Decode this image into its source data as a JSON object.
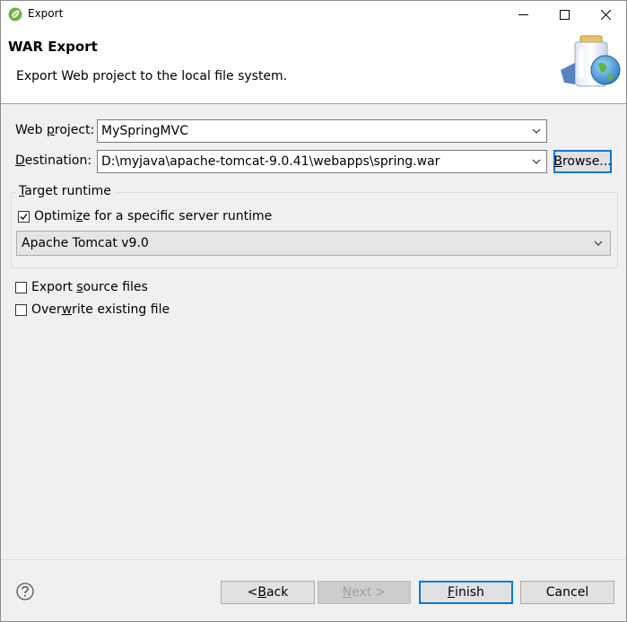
{
  "window": {
    "title": "Export",
    "icon": "spring-leaf-icon"
  },
  "controls": {
    "minimize": "minimize-icon",
    "maximize": "maximize-icon",
    "close": "close-icon"
  },
  "banner": {
    "title": "WAR Export",
    "description": "Export Web project to the local file system.",
    "image": "war-jar-globe-icon"
  },
  "form": {
    "web_project": {
      "label_pre": "Web ",
      "label_mnemonic": "p",
      "label_post": "roject:",
      "value": "MySpringMVC"
    },
    "destination": {
      "label_mnemonic": "D",
      "label_post": "estination:",
      "value": "D:\\myjava\\apache-tomcat-9.0.41\\webapps\\spring.war",
      "browse_mnemonic": "B",
      "browse_post": "rowse..."
    },
    "target_runtime": {
      "title_mnemonic": "T",
      "title_post": "arget runtime",
      "optimize_pre": "Optimi",
      "optimize_mnemonic": "z",
      "optimize_post": "e for a specific server runtime",
      "optimize_checked": true,
      "runtime_value": "Apache Tomcat v9.0"
    },
    "export_source": {
      "pre": "Export ",
      "mnemonic": "s",
      "post": "ource files",
      "checked": false
    },
    "overwrite": {
      "pre": "Over",
      "mnemonic": "w",
      "post": "rite existing file",
      "checked": false
    }
  },
  "footer": {
    "help_icon": "help-question-icon",
    "back_pre": "< ",
    "back_mnemonic": "B",
    "back_post": "ack",
    "next_mnemonic": "N",
    "next_post": "ext >",
    "finish_mnemonic": "F",
    "finish_post": "inish",
    "cancel": "Cancel"
  }
}
